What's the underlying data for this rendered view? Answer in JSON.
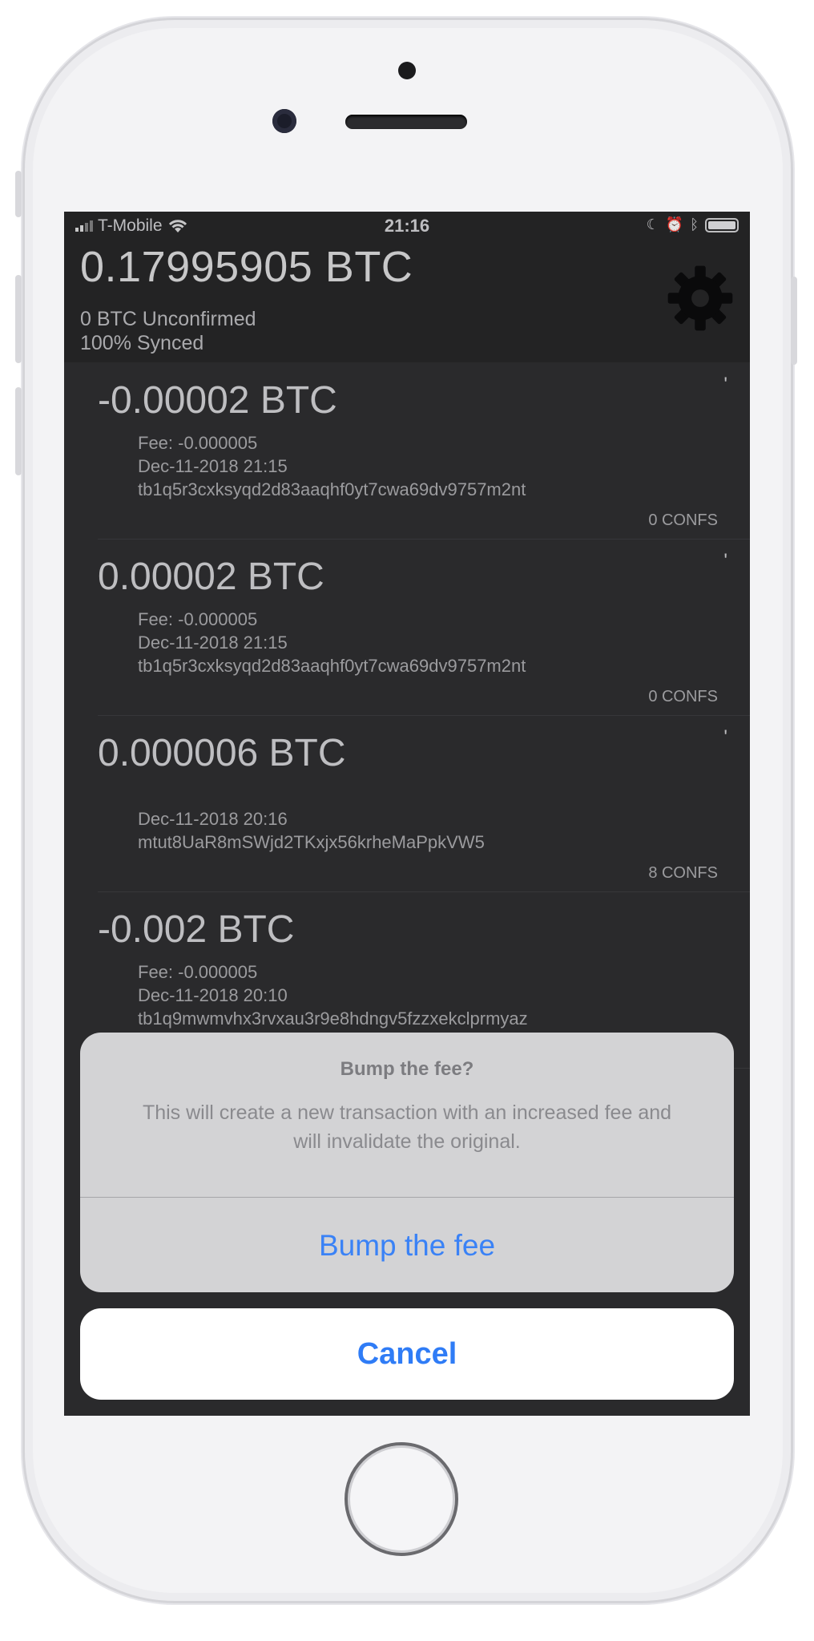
{
  "status_bar": {
    "carrier": "T-Mobile",
    "time": "21:16",
    "icons": [
      "signal-bars-icon",
      "wifi-icon",
      "moon-icon",
      "alarm-icon",
      "bluetooth-icon",
      "battery-icon"
    ]
  },
  "header": {
    "balance": "0.17995905 BTC",
    "unconfirmed": "0 BTC Unconfirmed",
    "synced": "100% Synced",
    "settings_icon": "gear-icon"
  },
  "transactions": [
    {
      "amount": "-0.00002 BTC",
      "mark": "'",
      "fee": "Fee: -0.000005",
      "date": "Dec-11-2018 21:15",
      "address": "tb1q5r3cxksyqd2d83aaqhf0yt7cwa69dv9757m2nt",
      "confs": "0 CONFS"
    },
    {
      "amount": "0.00002 BTC",
      "mark": "'",
      "fee": "Fee: -0.000005",
      "date": "Dec-11-2018 21:15",
      "address": "tb1q5r3cxksyqd2d83aaqhf0yt7cwa69dv9757m2nt",
      "confs": "0 CONFS"
    },
    {
      "amount": "0.000006 BTC",
      "mark": "'",
      "fee": "",
      "date": "Dec-11-2018 20:16",
      "address": "mtut8UaR8mSWjd2TKxjx56krheMaPpkVW5",
      "confs": "8 CONFS"
    },
    {
      "amount": "-0.002 BTC",
      "mark": "",
      "fee": "Fee: -0.000005",
      "date": "Dec-11-2018 20:10",
      "address": "tb1q9mwmvhx3rvxau3r9e8hdngv5fzzxekclprmyaz",
      "confs": ""
    }
  ],
  "alert": {
    "title": "Bump the fee?",
    "message": "This will create a new transaction with an increased fee and will invalidate the original.",
    "action_label": "Bump the fee",
    "cancel_label": "Cancel"
  },
  "colors": {
    "screen_bg": "#2e2e30",
    "header_bg": "#262628",
    "action_blue": "#3a82f6",
    "alert_bg": "#d3d3d5"
  }
}
